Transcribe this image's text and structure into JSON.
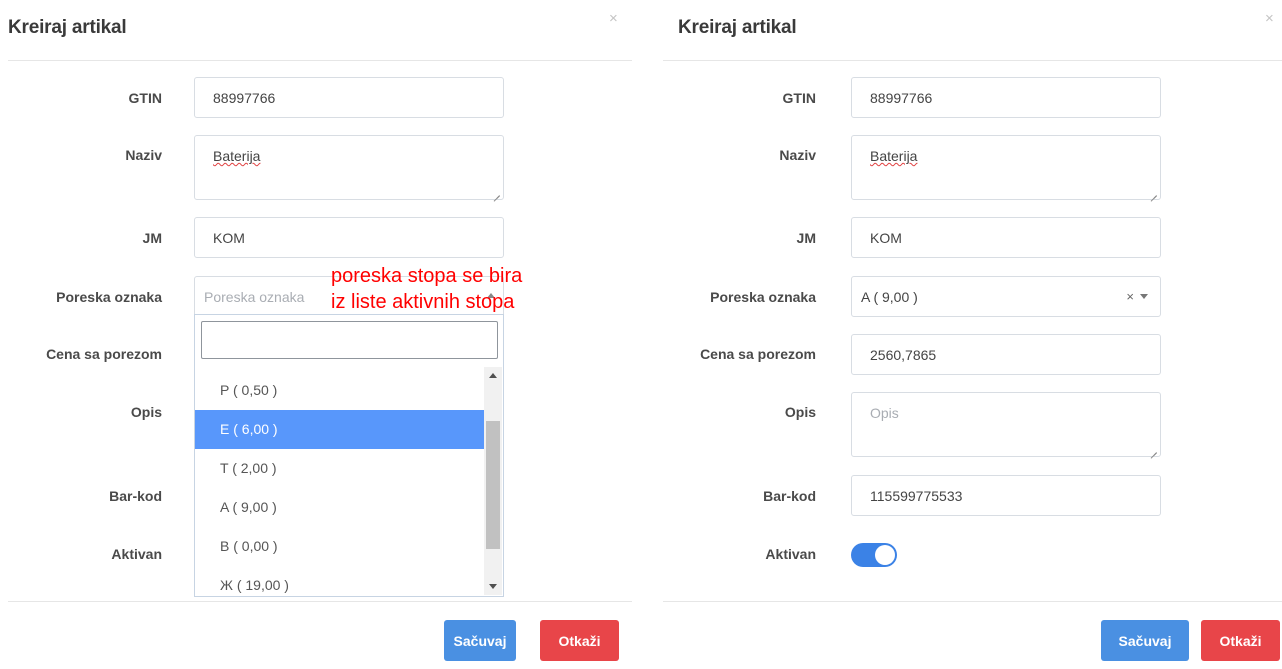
{
  "left": {
    "title": "Kreiraj artikal",
    "close": "×",
    "labels": {
      "gtin": "GTIN",
      "naziv": "Naziv",
      "jm": "JM",
      "poreska": "Poreska oznaka",
      "cena": "Cena sa porezom",
      "opis": "Opis",
      "barkod": "Bar-kod",
      "aktivan": "Aktivan"
    },
    "values": {
      "gtin": "88997766",
      "naziv": "Baterija",
      "jm": "KOM"
    },
    "poreska_placeholder": "Poreska oznaka",
    "dropdown_options": [
      "P ( 0,50 )",
      "E ( 6,00 )",
      "T ( 2,00 )",
      "A ( 9,00 )",
      "B ( 0,00 )",
      "Ж ( 19,00 )"
    ],
    "dropdown_highlighted": "E ( 6,00 )",
    "annotation": [
      "poreska stopa se bira",
      "iz liste aktivnih stopa"
    ],
    "buttons": {
      "save": "Sačuvaj",
      "cancel": "Otkaži"
    }
  },
  "right": {
    "title": "Kreiraj artikal",
    "close": "×",
    "labels": {
      "gtin": "GTIN",
      "naziv": "Naziv",
      "jm": "JM",
      "poreska": "Poreska oznaka",
      "cena": "Cena sa porezom",
      "opis": "Opis",
      "barkod": "Bar-kod",
      "aktivan": "Aktivan"
    },
    "values": {
      "gtin": "88997766",
      "naziv": "Baterija",
      "jm": "KOM",
      "poreska": "A ( 9,00 )",
      "cena": "2560,7865",
      "barkod": "115599775533"
    },
    "opis_placeholder": "Opis",
    "clear_symbol": "×",
    "aktivan": true,
    "buttons": {
      "save": "Sačuvaj",
      "cancel": "Otkaži"
    }
  },
  "colors": {
    "primary": "#4a90e2",
    "danger": "#e84549",
    "highlight": "#5897fb",
    "annotation": "#ff0000",
    "toggle_on": "#3b82e6"
  }
}
